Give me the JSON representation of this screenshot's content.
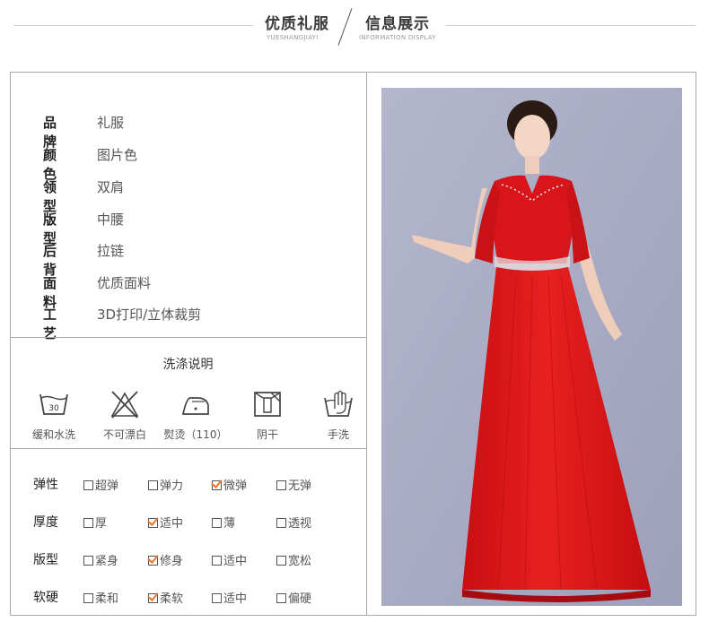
{
  "header": {
    "title_left": "优质礼服",
    "subtitle_left": "YUESHANGJIAYI",
    "title_right": "信息展示",
    "subtitle_right": "INFORMATION DISPLAY"
  },
  "spec": [
    {
      "key": "品牌",
      "value": "礼服"
    },
    {
      "key": "颜色",
      "value": "图片色"
    },
    {
      "key": "领型",
      "value": "双肩"
    },
    {
      "key": "版型",
      "value": "中腰"
    },
    {
      "key": "后背",
      "value": "拉链"
    },
    {
      "key": "面料",
      "value": "优质面料"
    },
    {
      "key": "工艺",
      "value": "3D打印/立体裁剪"
    }
  ],
  "care": {
    "title": "洗涤说明",
    "items": [
      {
        "icon": "wash-30-icon",
        "label": "缓和水洗",
        "badge": "30"
      },
      {
        "icon": "no-bleach-icon",
        "label": "不可漂白"
      },
      {
        "icon": "iron-icon",
        "label": "熨烫（110）"
      },
      {
        "icon": "shade-dry-icon",
        "label": "阴干"
      },
      {
        "icon": "hand-wash-icon",
        "label": "手洗"
      }
    ]
  },
  "attributes": [
    {
      "key": "弹性",
      "options": [
        {
          "label": "超弹",
          "checked": false
        },
        {
          "label": "弹力",
          "checked": false
        },
        {
          "label": "微弹",
          "checked": true
        },
        {
          "label": "无弹",
          "checked": false
        }
      ]
    },
    {
      "key": "厚度",
      "options": [
        {
          "label": "厚",
          "checked": false
        },
        {
          "label": "适中",
          "checked": true
        },
        {
          "label": "薄",
          "checked": false
        },
        {
          "label": "透视",
          "checked": false
        }
      ]
    },
    {
      "key": "版型",
      "options": [
        {
          "label": "紧身",
          "checked": false
        },
        {
          "label": "修身",
          "checked": true
        },
        {
          "label": "适中",
          "checked": false
        },
        {
          "label": "宽松",
          "checked": false
        }
      ]
    },
    {
      "key": "软硬",
      "options": [
        {
          "label": "柔和",
          "checked": false
        },
        {
          "label": "柔软",
          "checked": true
        },
        {
          "label": "适中",
          "checked": false
        },
        {
          "label": "偏硬",
          "checked": false
        }
      ]
    }
  ],
  "colors": {
    "accent_check": "#e8752a",
    "dress": "#e01818",
    "photo_bg": "#a9abc4"
  }
}
